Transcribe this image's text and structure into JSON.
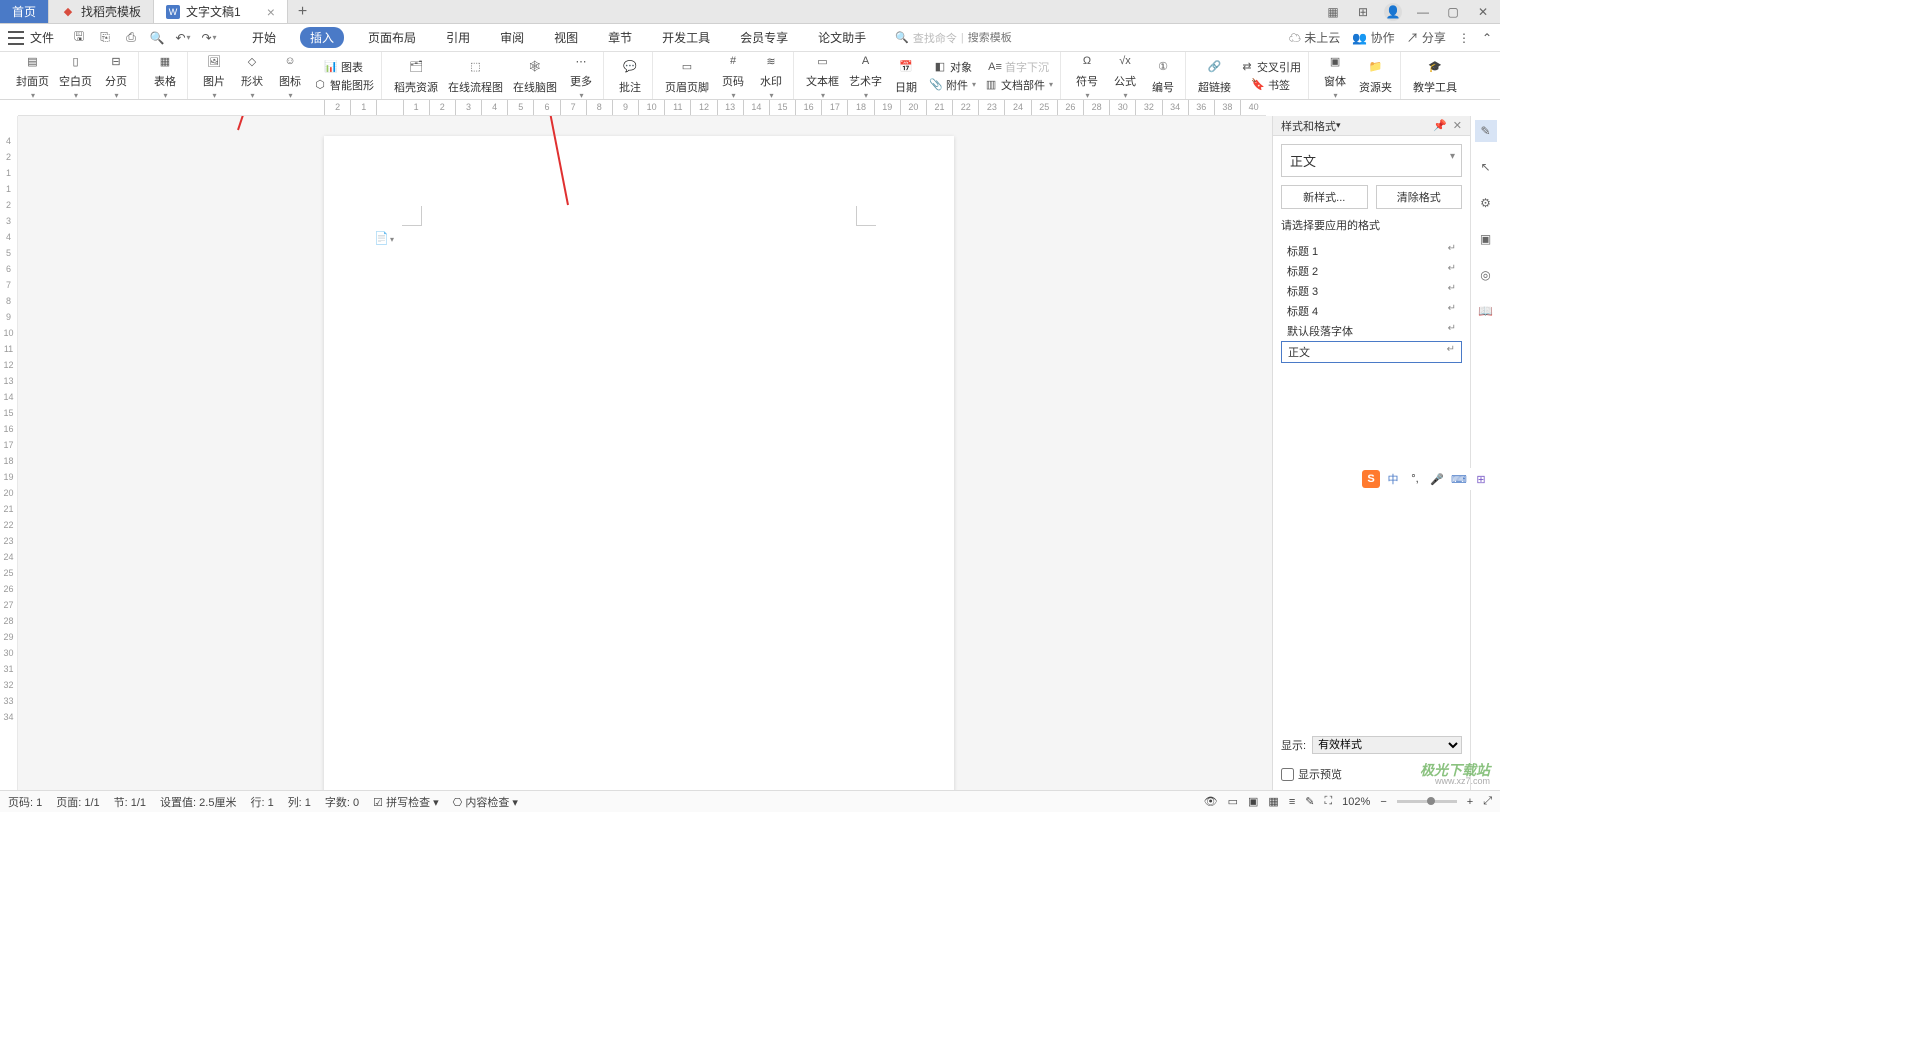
{
  "tabs": {
    "home": "首页",
    "template": "找稻壳模板",
    "doc": "文字文稿1"
  },
  "file_menu": "文件",
  "menu_tabs": [
    "开始",
    "插入",
    "页面布局",
    "引用",
    "审阅",
    "视图",
    "章节",
    "开发工具",
    "会员专享",
    "论文助手"
  ],
  "menu_active_index": 1,
  "search": {
    "placeholder_cmd": "查找命令",
    "placeholder_tpl": "搜索模板"
  },
  "cloud": {
    "not_uploaded": "未上云",
    "coop": "协作",
    "share": "分享"
  },
  "ribbon": {
    "cover": "封面页",
    "blank": "空白页",
    "pagebreak": "分页",
    "table": "表格",
    "picture": "图片",
    "shape": "形状",
    "icon": "图标",
    "chart": "图表",
    "smart": "智能图形",
    "docer": "稻壳资源",
    "flow": "在线流程图",
    "mind": "在线脑图",
    "more": "更多",
    "comment": "批注",
    "headerfooter": "页眉页脚",
    "pagenum": "页码",
    "watermark": "水印",
    "textbox": "文本框",
    "wordart": "艺术字",
    "date": "日期",
    "object": "对象",
    "dropcap": "首字下沉",
    "attach": "附件",
    "docpart": "文档部件",
    "symbol": "符号",
    "equation": "公式",
    "number": "编号",
    "hyperlink": "超链接",
    "bookmark": "书签",
    "crossref": "交叉引用",
    "window": "窗体",
    "resource": "资源夹",
    "teach": "教学工具"
  },
  "ruler_h": [
    2,
    1,
    "",
    1,
    2,
    3,
    4,
    5,
    6,
    7,
    8,
    9,
    10,
    11,
    12,
    13,
    14,
    15,
    16,
    17,
    18,
    19,
    20,
    21,
    22,
    23,
    24,
    25,
    26,
    28,
    30,
    32,
    34,
    36,
    38,
    40
  ],
  "ruler_v": [
    4,
    2,
    1,
    1,
    2,
    3,
    4,
    5,
    6,
    7,
    8,
    9,
    10,
    11,
    12,
    13,
    14,
    15,
    16,
    17,
    18,
    19,
    20,
    21,
    22,
    23,
    24,
    25,
    26,
    27,
    28,
    29,
    30,
    31,
    32,
    33,
    34
  ],
  "side": {
    "title": "样式和格式",
    "current": "正文",
    "new_btn": "新样式...",
    "clear_btn": "清除格式",
    "apply_label": "请选择要应用的格式",
    "styles": [
      "标题 1",
      "标题 2",
      "标题 3",
      "标题 4",
      "默认段落字体",
      "正文"
    ],
    "active_style_index": 5,
    "display_label": "显示:",
    "display_value": "有效样式",
    "preview": "显示预览"
  },
  "status": {
    "page_code": "页码: 1",
    "page": "页面: 1/1",
    "section": "节: 1/1",
    "pos": "设置值: 2.5厘米",
    "line": "行: 1",
    "col": "列: 1",
    "words": "字数: 0",
    "spell": "拼写检查",
    "content": "内容检查",
    "zoom": "102%"
  },
  "watermark": {
    "main": "极光下载站",
    "sub": "www.xz7.com"
  }
}
